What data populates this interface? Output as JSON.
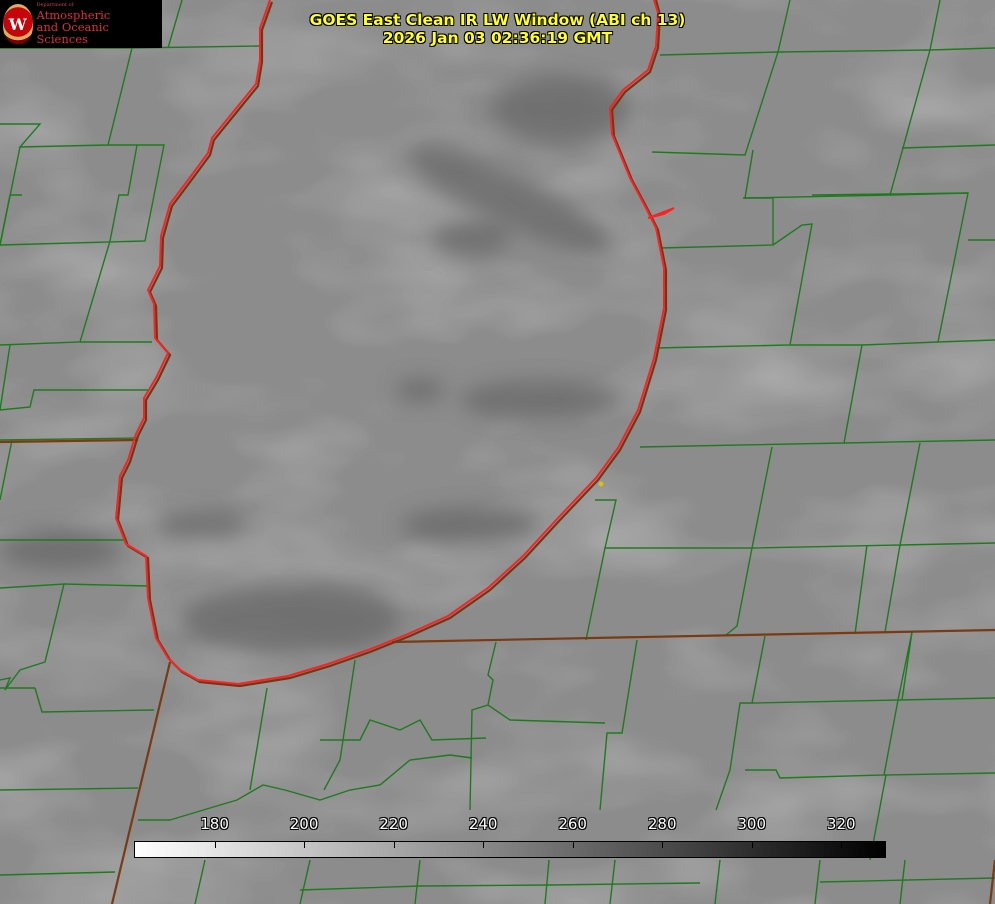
{
  "title": {
    "line1": "GOES East Clean IR LW Window (ABI ch 13)",
    "line2": "2026 Jan 03 02:36:19 GMT"
  },
  "logo": {
    "seal_letter": "W",
    "dept": "Department of",
    "line1": "Atmospheric",
    "line2": "and Oceanic Sciences"
  },
  "colorbar": {
    "min": 162,
    "max": 330,
    "ticks": [
      "180",
      "200",
      "220",
      "240",
      "260",
      "280",
      "300",
      "320"
    ],
    "colors": {
      "cold": "#ffffff",
      "warm": "#000000"
    }
  },
  "colors": {
    "background": "#8a8a8a",
    "county_lines": "#1f7a1f",
    "state_lines": "#7a3a12",
    "coastline": "#ff2020",
    "title_text": "#ffff22",
    "marker": "#d4c020"
  }
}
